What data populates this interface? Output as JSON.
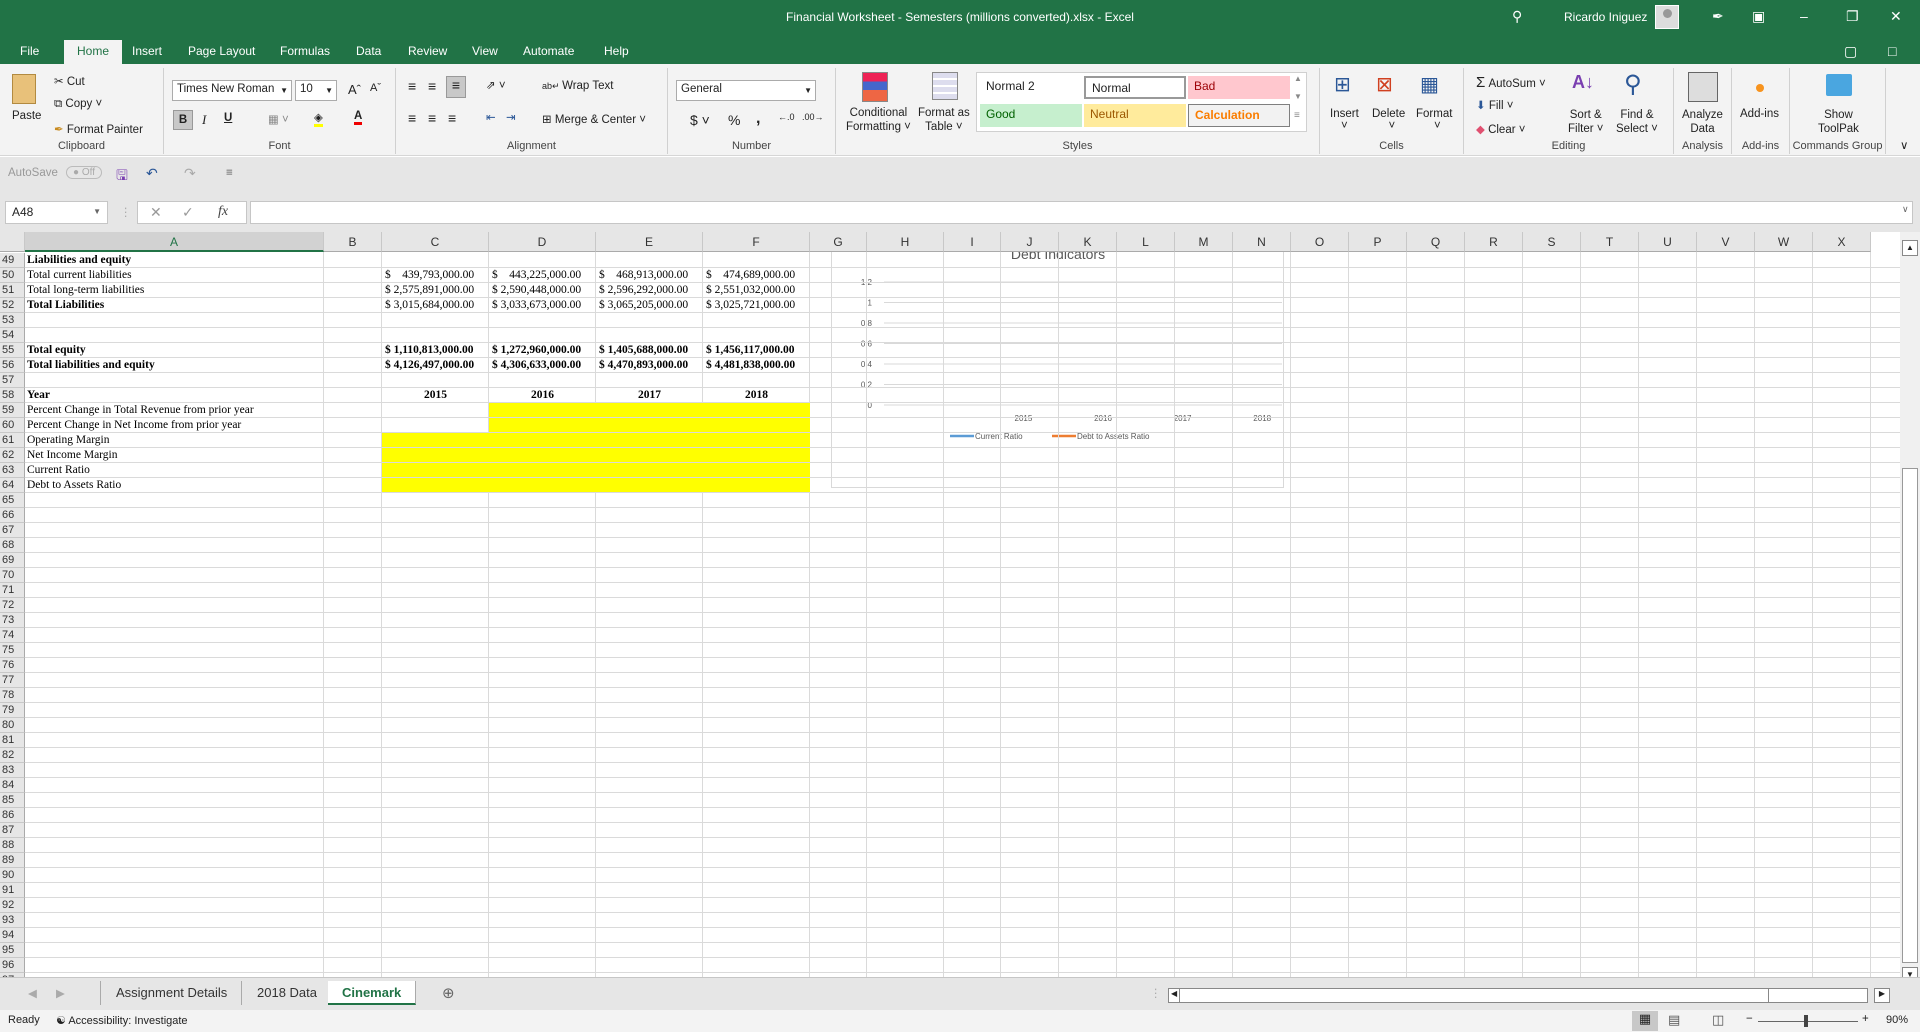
{
  "window": {
    "title": "Financial Worksheet - Semesters (millions converted).xlsx  -  Excel",
    "user": "Ricardo Iniguez",
    "icons": [
      "search-icon",
      "avatar",
      "pen-icon",
      "ribbon-display-icon",
      "minimize-icon",
      "restore-icon",
      "close-icon"
    ]
  },
  "tabs": [
    "File",
    "Home",
    "Insert",
    "Page Layout",
    "Formulas",
    "Data",
    "Review",
    "View",
    "Automate",
    "Help"
  ],
  "active_tab": "Home",
  "ribbon": {
    "clipboard": {
      "paste": "Paste",
      "cut": "Cut",
      "copy": "Copy",
      "format_painter": "Format Painter",
      "label": "Clipboard"
    },
    "font": {
      "name": "Times New Roman",
      "size": "10",
      "bold": "B",
      "italic": "I",
      "underline": "U",
      "label": "Font"
    },
    "alignment": {
      "wrap": "Wrap Text",
      "merge": "Merge & Center",
      "label": "Alignment"
    },
    "number": {
      "format": "General",
      "currency": "$",
      "percent": "%",
      "comma": ",",
      "label": "Number"
    },
    "styles": {
      "conditional": "Conditional",
      "conditional2": "Formatting",
      "format_table": "Format as",
      "format_table2": "Table",
      "cells": [
        {
          "label": "Normal 2",
          "bg": "#ffffff",
          "fg": "#000000"
        },
        {
          "label": "Normal",
          "bg": "#ffffff",
          "fg": "#000000"
        },
        {
          "label": "Bad",
          "bg": "#ffc7ce",
          "fg": "#9c0006"
        },
        {
          "label": "Good",
          "bg": "#c6efce",
          "fg": "#006100"
        },
        {
          "label": "Neutral",
          "bg": "#ffeb9c",
          "fg": "#9c5700"
        },
        {
          "label": "Calculation",
          "bg": "#f2f2f2",
          "fg": "#fa7d00"
        }
      ],
      "label": "Styles"
    },
    "cells": {
      "insert": "Insert",
      "delete": "Delete",
      "format": "Format",
      "label": "Cells"
    },
    "editing": {
      "autosum": "AutoSum",
      "fill": "Fill",
      "clear": "Clear",
      "sort": "Sort &",
      "sort2": "Filter",
      "find": "Find &",
      "find2": "Select",
      "label": "Editing"
    },
    "analysis": {
      "analyze": "Analyze",
      "analyze2": "Data",
      "label": "Analysis"
    },
    "addins": {
      "addins": "Add-ins",
      "label": "Add-ins"
    },
    "commands": {
      "show": "Show",
      "show2": "ToolPak",
      "label": "Commands Group"
    }
  },
  "qat": {
    "autosave": "AutoSave",
    "toggle": "Off"
  },
  "formula_bar": {
    "name_box": "A48",
    "fx": "fx",
    "formula": ""
  },
  "columns": [
    "A",
    "B",
    "C",
    "D",
    "E",
    "F",
    "G",
    "H",
    "I",
    "J",
    "K",
    "L",
    "M",
    "N",
    "O",
    "P",
    "Q",
    "R",
    "S",
    "T",
    "U",
    "V",
    "W",
    "X"
  ],
  "selected_column": "A",
  "rows": [
    {
      "n": "49",
      "a": "Liabilities and equity",
      "bold": true,
      "vals": []
    },
    {
      "n": "50",
      "a": "Total current liabilities",
      "bold": false,
      "vals": [
        "$    439,793,000.00",
        "$    443,225,000.00",
        "$    468,913,000.00",
        "$    474,689,000.00"
      ]
    },
    {
      "n": "51",
      "a": "Total long-term liabilities",
      "bold": false,
      "vals": [
        "$ 2,575,891,000.00",
        "$ 2,590,448,000.00",
        "$ 2,596,292,000.00",
        "$ 2,551,032,000.00"
      ]
    },
    {
      "n": "52",
      "a": "Total Liabilities",
      "bold": true,
      "vals": [
        "$ 3,015,684,000.00",
        "$ 3,033,673,000.00",
        "$ 3,065,205,000.00",
        "$ 3,025,721,000.00"
      ],
      "valsbold": false
    },
    {
      "n": "53",
      "a": "",
      "vals": []
    },
    {
      "n": "54",
      "a": "",
      "vals": []
    },
    {
      "n": "55",
      "a": "Total equity",
      "bold": true,
      "vals": [
        "$ 1,110,813,000.00",
        "$ 1,272,960,000.00",
        "$ 1,405,688,000.00",
        "$ 1,456,117,000.00"
      ],
      "valsbold": true
    },
    {
      "n": "56",
      "a": "Total liabilities and equity",
      "bold": true,
      "vals": [
        "$ 4,126,497,000.00",
        "$ 4,306,633,000.00",
        "$ 4,470,893,000.00",
        "$ 4,481,838,000.00"
      ],
      "valsbold": true
    },
    {
      "n": "57",
      "a": "",
      "vals": []
    },
    {
      "n": "58",
      "a": "Year",
      "bold": true,
      "vals": [
        "2015",
        "2016",
        "2017",
        "2018"
      ],
      "valsbold": true,
      "center": true
    },
    {
      "n": "59",
      "a": "Percent Change in Total Revenue from prior year",
      "vals": []
    },
    {
      "n": "60",
      "a": "Percent Change in Net Income from prior year",
      "vals": []
    },
    {
      "n": "61",
      "a": "Operating Margin",
      "vals": []
    },
    {
      "n": "62",
      "a": "Net Income Margin",
      "vals": []
    },
    {
      "n": "63",
      "a": "Current Ratio",
      "vals": []
    },
    {
      "n": "64",
      "a": "Debt to Assets Ratio",
      "vals": []
    }
  ],
  "highlight_color": "#ffff00",
  "chart_data": {
    "type": "line",
    "title": "Debt Indicators",
    "categories": [
      "",
      "2015",
      "2016",
      "2017",
      "2018"
    ],
    "series": [
      {
        "name": "Current Ratio",
        "color": "#5b9bd5",
        "values": [
          null,
          null,
          null,
          null,
          null
        ]
      },
      {
        "name": "Debt to Assets Ratio",
        "color": "#ed7d31",
        "values": [
          null,
          null,
          null,
          null,
          null
        ]
      }
    ],
    "yticks": [
      "0",
      "0.2",
      "0.4",
      "0.6",
      "0.8",
      "1",
      "1.2"
    ],
    "ylim": [
      0,
      1.2
    ],
    "grid": true,
    "legend": "bottom"
  },
  "sheets": [
    "Assignment Details",
    "2018 Data",
    "Cinemark"
  ],
  "active_sheet": "Cinemark",
  "status": {
    "ready": "Ready",
    "accessibility": "Accessibility: Investigate",
    "zoom": "90%"
  }
}
